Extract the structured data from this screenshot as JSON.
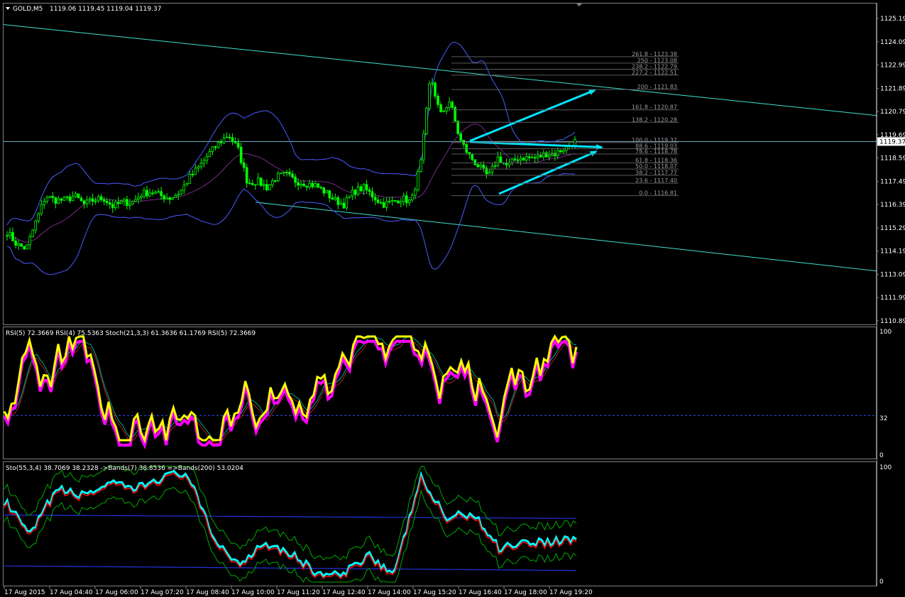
{
  "header": {
    "symbol": "GOLD,M5",
    "ohlc": "1119.06 1119.45 1119.04 1119.37"
  },
  "colors": {
    "background": "#000000",
    "candle": "#00ff00",
    "bollinger": "#4a5cff",
    "channel": "#40e0d0",
    "arrow": "#00e5ff",
    "bid_line": "#7fb2c8",
    "rsi5_fast": "#ff00ff",
    "rsi4": "#ffff00",
    "stoch_main": "#00ffff",
    "stoch_signal": "#ff0000",
    "bands7": "#00aa00",
    "bands200": "#2233dd"
  },
  "price_axis": {
    "labels": [
      "1125.19",
      "1124.09",
      "1122.99",
      "1121.89",
      "1120.79",
      "1119.69",
      "1118.59",
      "1117.49",
      "1116.39",
      "1115.29",
      "1114.19",
      "1113.09",
      "1111.99",
      "1110.89"
    ],
    "current": "1119.37"
  },
  "fibonacci": {
    "levels": [
      {
        "text": "261.8 - 1123.38",
        "value": 1123.38
      },
      {
        "text": "250 - 1123.08",
        "value": 1123.08
      },
      {
        "text": "238.2 - 1122.79",
        "value": 1122.79
      },
      {
        "text": "227.2 - 1122.51",
        "value": 1122.51
      },
      {
        "text": "200 - 1121.83",
        "value": 1121.83
      },
      {
        "text": "161.8 - 1120.87",
        "value": 1120.87
      },
      {
        "text": "138.2 - 1120.28",
        "value": 1120.28
      },
      {
        "text": "100.0 - 1119.32",
        "value": 1119.32
      },
      {
        "text": "88.6 - 1119.03",
        "value": 1119.03
      },
      {
        "text": "78.6 - 1118.78",
        "value": 1118.78
      },
      {
        "text": "61.8 - 1118.36",
        "value": 1118.36
      },
      {
        "text": "50.0 - 1118.07",
        "value": 1118.07
      },
      {
        "text": "38.2 - 1117.77",
        "value": 1117.77
      },
      {
        "text": "23.6 - 1117.40",
        "value": 1117.4
      },
      {
        "text": "0.0 - 1116.81",
        "value": 1116.81
      }
    ]
  },
  "rsi_panel": {
    "legend": "RSI(5) 72.3669  RSI(4) 75.5363  Stoch(21,3,3) 61.3636 61.1769  RSI(5) 72.3669",
    "axis_top": "100",
    "axis_level": "32",
    "axis_bottom": "0"
  },
  "sto_panel": {
    "legend": "Sto(55,3,4) 38.7069 38.2328  ->Bands(7) 38.8536  =>Bands(200) 53.0204",
    "axis_top": "100",
    "axis_bottom": "0"
  },
  "time_axis": {
    "labels": [
      "17 Aug 2015",
      "17 Aug 04:40",
      "17 Aug 06:00",
      "17 Aug 07:20",
      "17 Aug 08:40",
      "17 Aug 10:00",
      "17 Aug 11:20",
      "17 Aug 12:40",
      "17 Aug 14:00",
      "17 Aug 15:20",
      "17 Aug 16:40",
      "17 Aug 18:00",
      "17 Aug 19:20"
    ]
  },
  "chart_data": {
    "type": "candlestick",
    "title": "GOLD,M5",
    "ylim": [
      1110.89,
      1125.19
    ],
    "bid": 1119.37,
    "close_path": [
      [
        "17 Aug 2015",
        1115.1
      ],
      [
        "",
        1114.5
      ],
      [
        "",
        1114.3
      ],
      [
        "",
        1115.6
      ],
      [
        "",
        1116.8
      ],
      [
        "",
        1116.6
      ],
      [
        "17 Aug 04:40",
        1116.6
      ],
      [
        "",
        1116.8
      ],
      [
        "",
        1116.4
      ],
      [
        "",
        1116.6
      ],
      [
        "",
        1116.7
      ],
      [
        "",
        1116.3
      ],
      [
        "17 Aug 06:00",
        1116.5
      ],
      [
        "",
        1116.5
      ],
      [
        "",
        1116.9
      ],
      [
        "",
        1117.0
      ],
      [
        "",
        1116.8
      ],
      [
        "",
        1116.7
      ],
      [
        "17 Aug 07:20",
        1117.0
      ],
      [
        "",
        1117.7
      ],
      [
        "",
        1118.2
      ],
      [
        "",
        1118.8
      ],
      [
        "",
        1119.3
      ],
      [
        "",
        1119.7
      ],
      [
        "17 Aug 08:40",
        1119.0
      ],
      [
        "",
        1117.4
      ],
      [
        "",
        1117.5
      ],
      [
        "",
        1117.2
      ],
      [
        "",
        1117.7
      ],
      [
        "",
        1117.8
      ],
      [
        "17 Aug 10:00",
        1117.5
      ],
      [
        "",
        1117.4
      ],
      [
        "",
        1117.3
      ],
      [
        "",
        1117.0
      ],
      [
        "",
        1116.6
      ],
      [
        "",
        1116.4
      ],
      [
        "17 Aug 11:20",
        1117.0
      ],
      [
        "",
        1117.2
      ],
      [
        "",
        1116.8
      ],
      [
        "",
        1116.4
      ],
      [
        "",
        1116.5
      ],
      [
        "",
        1116.7
      ],
      [
        "17 Aug 12:40",
        1116.5
      ],
      [
        "",
        1118.4
      ],
      [
        "",
        1122.5
      ],
      [
        "",
        1120.6
      ],
      [
        "",
        1121.3
      ],
      [
        "",
        1119.5
      ],
      [
        "17 Aug 14:00",
        1118.7
      ],
      [
        "",
        1118.2
      ],
      [
        "",
        1117.7
      ],
      [
        "",
        1118.6
      ],
      [
        "",
        1118.2
      ],
      [
        "",
        1118.6
      ],
      [
        "17 Aug 15:20",
        1118.6
      ],
      [
        "",
        1118.6
      ],
      [
        "",
        1118.8
      ],
      [
        "",
        1118.8
      ],
      [
        "",
        1119.1
      ],
      [
        "",
        1119.37
      ]
    ],
    "fib_retracement": {
      "from": 1116.81,
      "to": 1119.32
    },
    "rsi_level": 32,
    "rsi_ylim": [
      0,
      100
    ],
    "sto_ylim": [
      0,
      100
    ]
  }
}
